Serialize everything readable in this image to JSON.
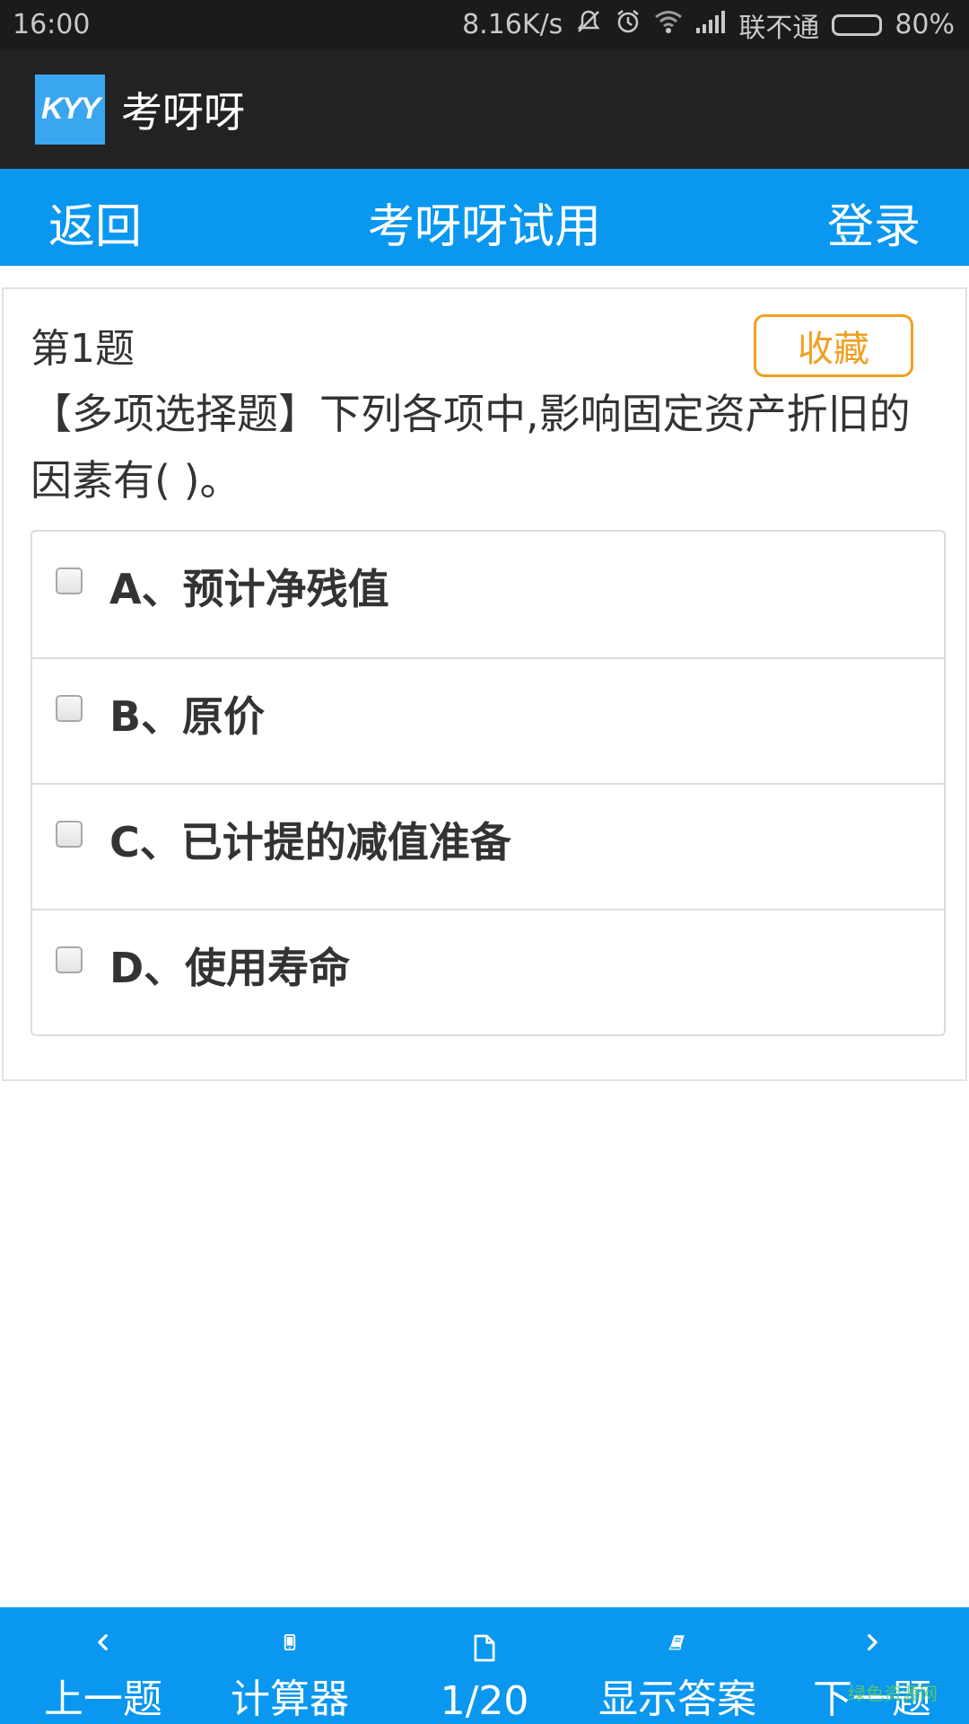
{
  "status_bar": {
    "time": "16:00",
    "net_speed": "8.16K/s",
    "carrier": "联不通",
    "battery_text": "80%",
    "battery_level": 0.8,
    "icons": [
      "mute-icon",
      "alarm-icon",
      "wifi-icon",
      "signal-icon",
      "battery-icon"
    ]
  },
  "app_bar": {
    "logo_text": "KYY",
    "title": "考呀呀"
  },
  "nav": {
    "back_label": "返回",
    "title": "考呀呀试用",
    "login_label": "登录"
  },
  "question": {
    "number_label": "第1题",
    "favorite_label": "收藏",
    "text": "【多项选择题】下列各项中,影响固定资产折旧的因素有( )。",
    "options": [
      {
        "label": "A、预计净残值",
        "checked": false
      },
      {
        "label": "B、原价",
        "checked": false
      },
      {
        "label": "C、已计提的减值准备",
        "checked": false
      },
      {
        "label": "D、使用寿命",
        "checked": false
      }
    ]
  },
  "bottom_bar": {
    "items": [
      {
        "icon": "chevron-left-icon",
        "label": "上一题"
      },
      {
        "icon": "phone-icon",
        "label": "计算器"
      },
      {
        "icon": "document-icon",
        "label": "1/20"
      },
      {
        "icon": "book-icon",
        "label": "显示答案"
      },
      {
        "icon": "chevron-right-icon",
        "label": "下一题"
      }
    ]
  },
  "watermark": "绿色资源网",
  "colors": {
    "primary_blue": "#0a97f0",
    "app_bar": "#222222",
    "favorite_orange": "#f0a020"
  }
}
